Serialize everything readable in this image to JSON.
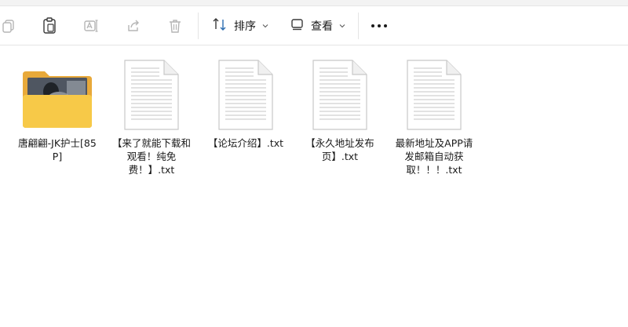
{
  "toolbar": {
    "sort_label": "排序",
    "view_label": "查看"
  },
  "files": [
    {
      "name": "唐翩翩-JK护士[85P]",
      "type": "folder"
    },
    {
      "name": "【来了就能下载和观看！纯免费！】.txt",
      "type": "txt"
    },
    {
      "name": "【论坛介绍】.txt",
      "type": "txt"
    },
    {
      "name": "【永久地址发布页】.txt",
      "type": "txt"
    },
    {
      "name": "最新地址及APP请发邮箱自动获取！！！.txt",
      "type": "txt"
    }
  ],
  "colors": {
    "folder": "#f7c948",
    "folder_back": "#e8a93a",
    "accent_blue": "#2b6cb0"
  }
}
